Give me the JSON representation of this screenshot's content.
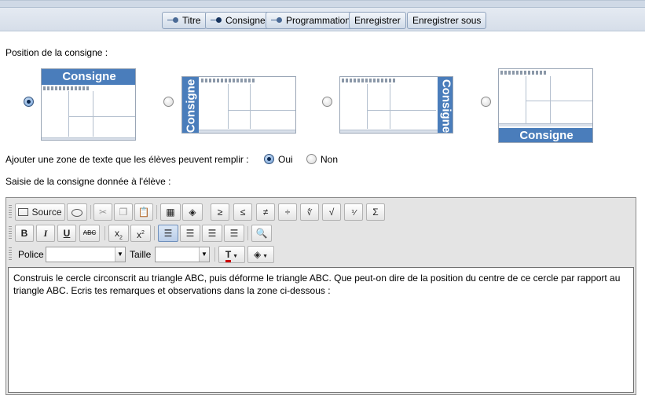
{
  "tabs": [
    {
      "label": "Titre",
      "bullet": true
    },
    {
      "label": "Consigne",
      "bullet": true,
      "active": true
    },
    {
      "label": "Programmation",
      "bullet": true
    },
    {
      "label": "Enregistrer",
      "bullet": false
    },
    {
      "label": "Enregistrer sous",
      "bullet": false
    }
  ],
  "position_section": {
    "label": "Position de la consigne :",
    "selected": "top",
    "banner_text": "Consigne",
    "options": [
      "top",
      "left",
      "right",
      "bottom"
    ]
  },
  "text_zone": {
    "label": "Ajouter une zone de texte que les élèves peuvent remplir :",
    "options": [
      {
        "label": "Oui",
        "checked": true
      },
      {
        "label": "Non",
        "checked": false
      }
    ]
  },
  "instruction_section": {
    "label": "Saisie de la consigne donnée à l'élève :"
  },
  "editor": {
    "toolbar": {
      "source_label": "Source",
      "font_label": "Police",
      "size_label": "Taille",
      "font_value": "",
      "size_value": ""
    },
    "content": " Construis le cercle circonscrit au triangle ABC, puis déforme le triangle ABC. Que peut-on dire de la position du centre de ce cercle par rapport au triangle ABC. Ecris tes remarques et observations dans la zone ci-dessous :"
  },
  "colors": {
    "banner": "#4a7dbb",
    "toolbar_bg": "#e4e4e4"
  }
}
